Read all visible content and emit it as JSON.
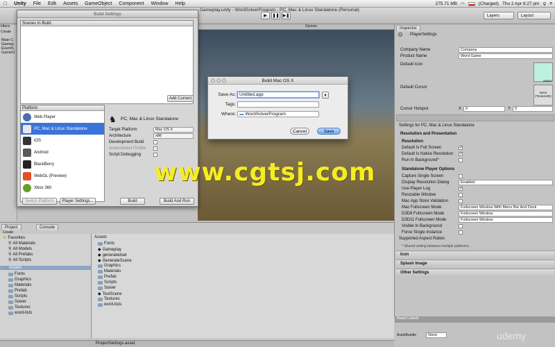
{
  "menubar": {
    "app": "Unity",
    "items": [
      "File",
      "Edit",
      "Assets",
      "GameObject",
      "Component",
      "Window",
      "Help"
    ],
    "memory": "275.71 MB",
    "battery": "(Charged)",
    "clock": "Thu 2 Apr  6:27 pm"
  },
  "window_title": "Gameplay.unity - WordSolverProgram - PC, Mac & Linux Standalone (Personal)",
  "toolbar": {
    "layers": "Layers",
    "layout": "Layout"
  },
  "build_settings": {
    "title": "Build Settings",
    "scenes_header": "Scenes In Build",
    "add_current": "Add Current",
    "platform_header": "Platform",
    "platforms": [
      "Web Player",
      "PC, Mac & Linux Standalone",
      "iOS",
      "Android",
      "BlackBerry",
      "WebGL (Preview)",
      "Xbox 360"
    ],
    "selected_title": "PC, Mac & Linux Standalone",
    "target_platform_label": "Target Platform",
    "target_platform": "Mac OS X",
    "architecture_label": "Architecture",
    "architecture": "x86",
    "dev_build": "Development Build",
    "autoconnect": "Autoconnect Profiler",
    "script_debug": "Script Debugging",
    "switch_platform": "Switch Platform",
    "player_settings": "Player Settings...",
    "build": "Build",
    "build_and_run": "Build And Run"
  },
  "dialog": {
    "title": "Build Mac OS X",
    "save_as_label": "Save As:",
    "save_as": "Untitled.app",
    "tags_label": "Tags:",
    "where_label": "Where:",
    "where": "WordSolverProgram",
    "cancel": "Cancel",
    "save": "Save"
  },
  "hierarchy": {
    "tab": "Hiera",
    "create": "Create",
    "items": [
      "Main C",
      "Gamep",
      "EventS",
      "GameO"
    ]
  },
  "scene": {
    "gizmos": "Gizmos"
  },
  "inspector": {
    "tab": "Inspector",
    "object": "PlayerSettings",
    "company_label": "Company Name",
    "company": "Company",
    "product_label": "Product Name",
    "product": "Word Game",
    "default_icon": "Default Icon",
    "default_cursor": "Default Cursor",
    "select": "Select",
    "cursor_none": "None",
    "cursor_type": "(Texture2D)",
    "hotspot_label": "Cursor Hotspot",
    "hx": "X",
    "hx_val": "0",
    "hy": "Y",
    "hy_val": "0",
    "settings_for": "Settings for PC, Mac & Linux Standalone",
    "res_header": "Resolution and Presentation",
    "resolution": "Resolution",
    "default_fullscreen": "Default Is Full Screen",
    "native_res": "Default Is Native Resolution",
    "run_bg": "Run In Background*",
    "standalone_header": "Standalone Player Options",
    "capture_single": "Capture Single Screen",
    "display_dialog": "Display Resolution Dialog",
    "display_dialog_val": "Enabled",
    "use_player_log": "Use Player Log",
    "resizable": "Resizable Window",
    "app_store": "Mac App Store Validation",
    "mac_fs": "Mac Fullscreen Mode",
    "mac_fs_val": "Fullscreen Window With Menu Bar And Dock",
    "d3d9": "D3D9 Fullscreen Mode",
    "d3d9_val": "Fullscreen Window",
    "d3d11": "D3D11 Fullscreen Mode",
    "d3d11_val": "Fullscreen Window",
    "visible_bg": "Visible In Background",
    "force_single": "Force Single Instance",
    "aspect": "Supported Aspect Ratios",
    "shared_note": "* Shared setting between multiple platforms.",
    "icon_section": "Icon",
    "splash": "Splash Image",
    "other": "Other Settings",
    "asset_labels": "Asset Labels",
    "asset_bundle": "AssetBundle",
    "none": "None"
  },
  "project": {
    "tab_project": "Project",
    "tab_console": "Console",
    "create": "Create",
    "favorites": "Favorites",
    "fav_items": [
      "All Materials",
      "All Models",
      "All Prefabs",
      "All Scripts"
    ],
    "assets": "Assets",
    "tree": [
      "Fonts",
      "Graphics",
      "Materials",
      "Prefab",
      "Scripts",
      "Solver",
      "Textures",
      "word-lists"
    ],
    "breadcrumb": "Assets",
    "files": [
      "Fonts",
      "Gameplay",
      "generatedset",
      "GenerateScene",
      "Graphics",
      "Materials",
      "Prefab",
      "Scripts",
      "Solver",
      "TestScene",
      "Textures",
      "word-lists"
    ],
    "footer": "ProjectSettings.asset"
  },
  "watermark": "www.cgtsj.com",
  "udemy": "udemy"
}
